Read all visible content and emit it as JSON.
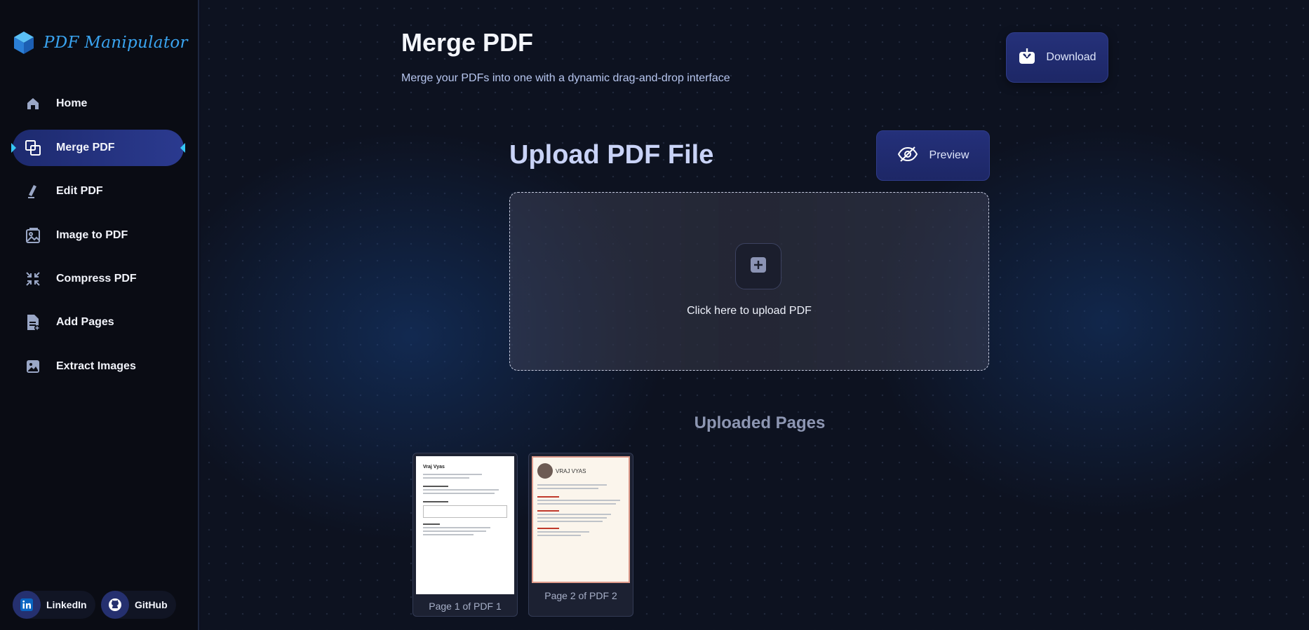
{
  "brand": {
    "name": "PDF Manipulator"
  },
  "sidebar": {
    "items": [
      {
        "label": "Home",
        "icon": "home-icon"
      },
      {
        "label": "Merge PDF",
        "icon": "merge-icon",
        "active": true
      },
      {
        "label": "Edit PDF",
        "icon": "pen-icon"
      },
      {
        "label": "Image to PDF",
        "icon": "image-file-icon"
      },
      {
        "label": "Compress PDF",
        "icon": "compress-icon"
      },
      {
        "label": "Add Pages",
        "icon": "add-page-icon"
      },
      {
        "label": "Extract Images",
        "icon": "image-icon"
      }
    ],
    "social": [
      {
        "label": "LinkedIn",
        "icon": "linkedin-icon"
      },
      {
        "label": "GitHub",
        "icon": "github-icon"
      }
    ]
  },
  "header": {
    "title": "Merge PDF",
    "subtitle": "Merge your PDFs into one with a dynamic drag-and-drop interface",
    "download_label": "Download"
  },
  "upload": {
    "title": "Upload PDF File",
    "preview_label": "Preview",
    "dropzone_label": "Click here to upload PDF"
  },
  "pages": {
    "title": "Uploaded Pages",
    "items": [
      {
        "caption": "Page 1 of PDF 1",
        "resume_name": "Vraj Vyas"
      },
      {
        "caption": "Page 2 of PDF 2",
        "resume_name": "VRAJ VYAS"
      }
    ]
  },
  "colors": {
    "accent": "#35c7f5",
    "brand": "#3aa4f0",
    "button": "#25317a"
  }
}
